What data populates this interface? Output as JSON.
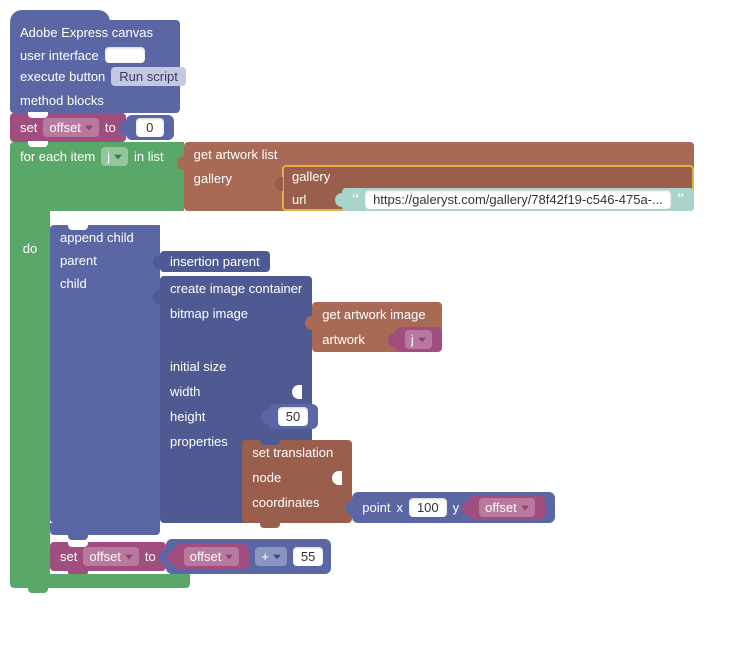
{
  "header": {
    "title": "Adobe Express canvas",
    "ui": "user interface",
    "execute": "execute button",
    "run": "Run script",
    "methods": "method blocks"
  },
  "set1": {
    "setLabel": "set",
    "var": "offset",
    "to": "to",
    "value": "0"
  },
  "forEach": {
    "label1": "for each item",
    "var": "j",
    "label2": "in list",
    "doLabel": "do"
  },
  "getList": {
    "title": "get artwork list",
    "galleryLabel": "gallery",
    "galleryInner": "gallery",
    "urlLabel": "url",
    "url": "https://galeryst.com/gallery/78f42f19-c546-475a-..."
  },
  "append": {
    "title": "append child",
    "parentLabel": "parent",
    "childLabel": "child",
    "insertionParent": "insertion parent"
  },
  "createImg": {
    "title": "create image container",
    "bitmapLabel": "bitmap image",
    "initialSize": "initial size",
    "widthLabel": "width",
    "heightLabel": "height",
    "heightVal": "50",
    "propertiesLabel": "properties"
  },
  "getImg": {
    "title": "get artwork image",
    "artworkLabel": "artwork",
    "var": "j"
  },
  "setTrans": {
    "title": "set translation",
    "nodeLabel": "node",
    "coordLabel": "coordinates"
  },
  "point": {
    "label": "point",
    "x": "x",
    "xVal": "100",
    "y": "y",
    "yVar": "offset"
  },
  "set2": {
    "setLabel": "set",
    "var": "offset",
    "to": "to",
    "lhs": "offset",
    "op": "+",
    "rhs": "55"
  }
}
